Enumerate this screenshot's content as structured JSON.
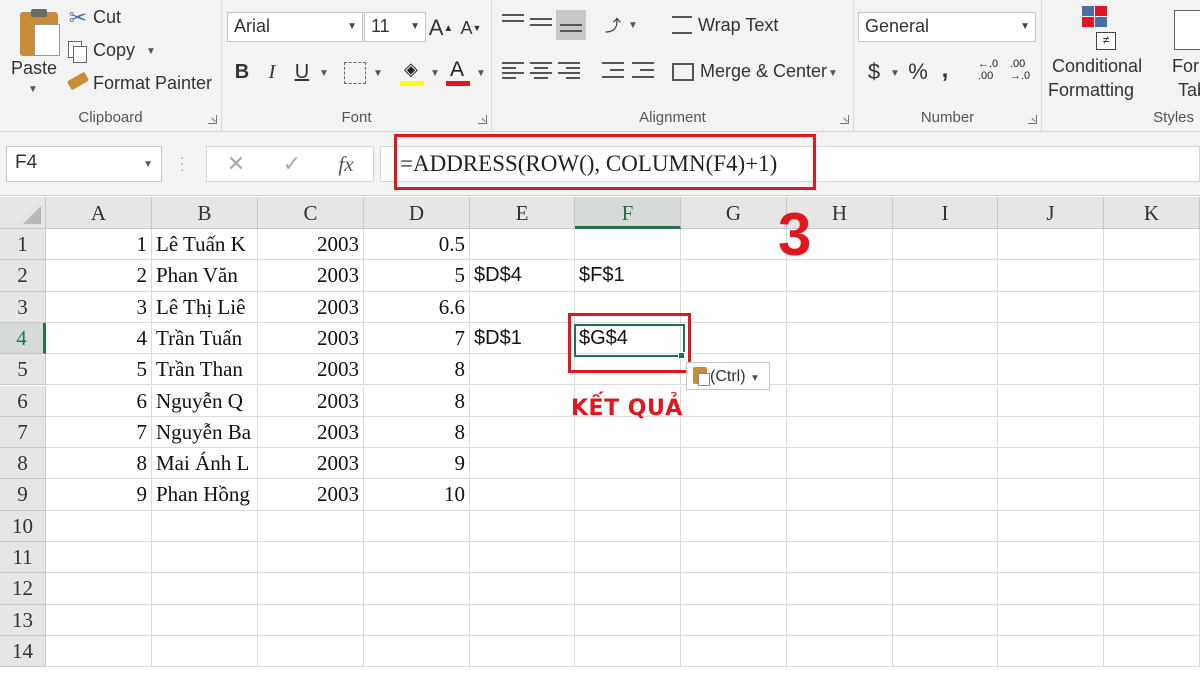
{
  "ribbon": {
    "clipboard": {
      "paste_label": "Paste",
      "cut_label": "Cut",
      "copy_label": "Copy",
      "format_painter_label": "Format Painter",
      "group_label": "Clipboard"
    },
    "font": {
      "font_name": "Arial",
      "font_size": "11",
      "bold": "B",
      "italic": "I",
      "underline": "U",
      "group_label": "Font"
    },
    "alignment": {
      "wrap_text_label": "Wrap Text",
      "merge_center_label": "Merge & Center",
      "group_label": "Alignment"
    },
    "number": {
      "format": "General",
      "currency": "$",
      "percent": "%",
      "comma": ",",
      "group_label": "Number"
    },
    "styles": {
      "conditional_line1": "Conditional",
      "conditional_line2": "Formatting",
      "format_table_line1": "Form",
      "format_table_line2": "Tab",
      "group_label": "Styles"
    }
  },
  "formula_bar": {
    "name_box": "F4",
    "fx_label": "fx",
    "formula": "=ADDRESS(ROW(), COLUMN(F4)+1)"
  },
  "columns": [
    "A",
    "B",
    "C",
    "D",
    "E",
    "F",
    "G",
    "H",
    "I",
    "J",
    "K"
  ],
  "rows": [
    "1",
    "2",
    "3",
    "4",
    "5",
    "6",
    "7",
    "8",
    "9",
    "10",
    "11",
    "12",
    "13",
    "14"
  ],
  "cells": {
    "A1": "1",
    "B1": "Lê Tuấn K",
    "C1": "2003",
    "D1": "0.5",
    "A2": "2",
    "B2": "Phan Văn",
    "C2": "2003",
    "D2": "5",
    "E2": "$D$4",
    "F2": "$F$1",
    "A3": "3",
    "B3": "Lê Thị Liê",
    "C3": "2003",
    "D3": "6.6",
    "A4": "4",
    "B4": "Trần Tuấn",
    "C4": "2003",
    "D4": "7",
    "E4": "$D$1",
    "F4": "$G$4",
    "A5": "5",
    "B5": "Trần Than",
    "C5": "2003",
    "D5": "8",
    "A6": "6",
    "B6": "Nguyễn Q",
    "C6": "2003",
    "D6": "8",
    "A7": "7",
    "B7": "Nguyễn Ba",
    "C7": "2003",
    "D7": "8",
    "A8": "8",
    "B8": "Mai Ánh L",
    "C8": "2003",
    "D8": "9",
    "A9": "9",
    "B9": "Phan Hồng",
    "C9": "2003",
    "D9": "10"
  },
  "selected_cell": "F4",
  "paste_options_label": "(Ctrl)",
  "annotations": {
    "step_number": "3",
    "result_label": "KẾT QUẢ"
  },
  "colors": {
    "accent": "#217346",
    "annotation_red": "#e0171f",
    "ribbon_bg": "#f3f3f3"
  }
}
